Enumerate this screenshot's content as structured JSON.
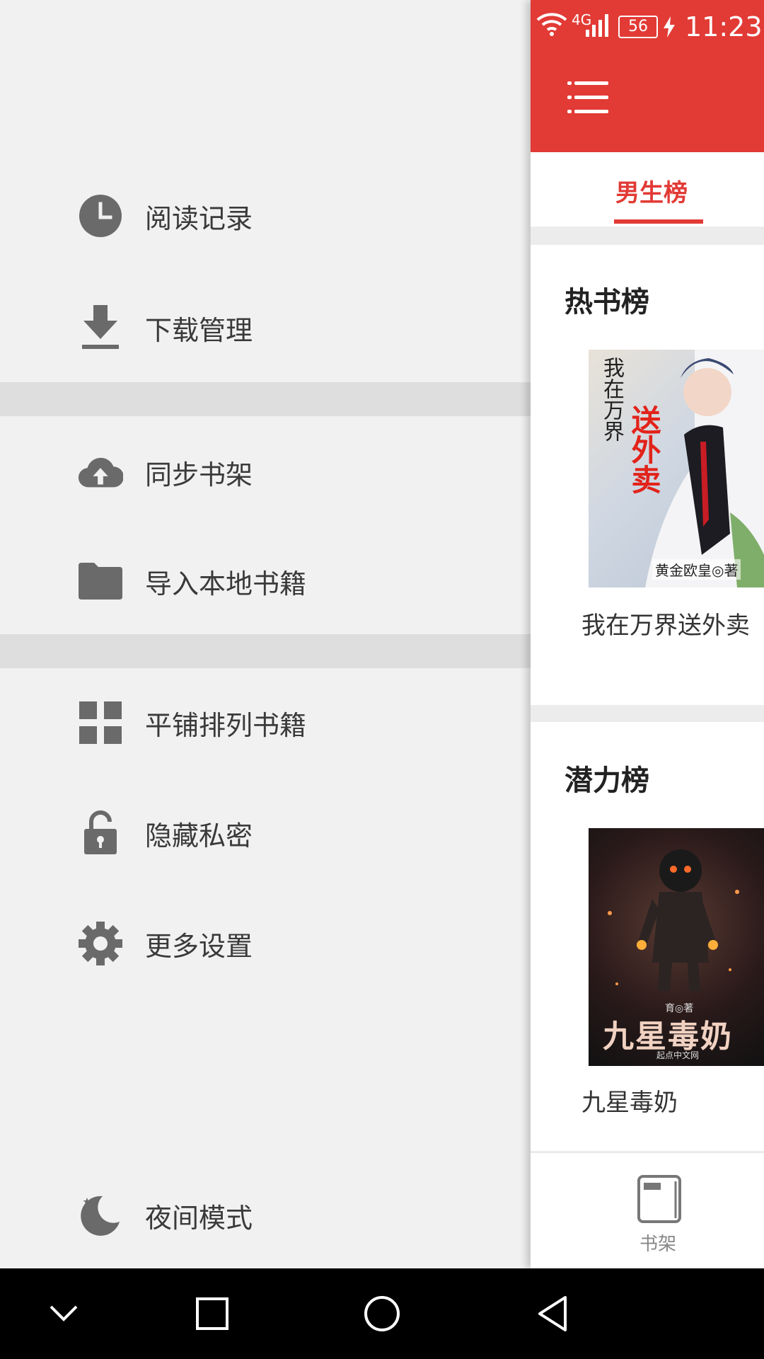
{
  "status_bar": {
    "time": "11:23",
    "battery": "56",
    "network": "4G"
  },
  "drawer": {
    "items": [
      {
        "label": "阅读记录",
        "icon": "history-clock-icon"
      },
      {
        "label": "下载管理",
        "icon": "download-icon"
      },
      {
        "label": "同步书架",
        "icon": "cloud-upload-icon"
      },
      {
        "label": "导入本地书籍",
        "icon": "folder-icon"
      },
      {
        "label": "平铺排列书籍",
        "icon": "grid-icon"
      },
      {
        "label": "隐藏私密",
        "icon": "lock-icon"
      },
      {
        "label": "更多设置",
        "icon": "gear-icon"
      },
      {
        "label": "夜间模式",
        "icon": "moon-icon"
      }
    ]
  },
  "main": {
    "active_tab": "男生榜",
    "sections": [
      {
        "title": "热书榜",
        "book_title": "我在万界送外卖",
        "cover_text": [
          "我在万界",
          "送外卖"
        ],
        "cover_author": "黄金欧皇◎著"
      },
      {
        "title": "潜力榜",
        "book_title": "九星毒奶",
        "cover_text": [
          "九星毒奶"
        ],
        "cover_author": "育◎著",
        "cover_publisher": "起点中文网"
      }
    ],
    "bottom_nav": {
      "label": "书架"
    }
  },
  "colors": {
    "brand_red": "#e23a35",
    "drawer_bg": "#f1f1f1",
    "icon_gray": "#6a6a6a"
  }
}
